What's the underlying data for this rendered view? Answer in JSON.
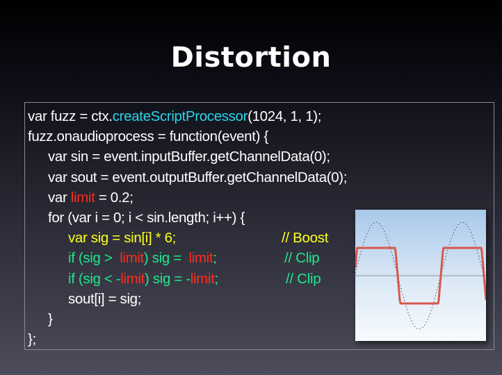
{
  "slide": {
    "title": "Distortion"
  },
  "colors": {
    "default": "#ffffff",
    "cyan": "#27d6ea",
    "red": "#ff2b1c",
    "yellow": "#ffff1e",
    "green": "#1fe88a",
    "clip_curve": "#d9574c",
    "axis": "#9ea4ab",
    "sine_dots": "#444a55"
  },
  "code": {
    "lines": [
      {
        "indent": 0,
        "segments": [
          {
            "text": "var fuzz = ctx.",
            "color": "default"
          },
          {
            "text": "createScriptProcessor",
            "color": "cyan"
          },
          {
            "text": "(1024, 1, 1);",
            "color": "default"
          }
        ]
      },
      {
        "indent": 0,
        "segments": [
          {
            "text": "fuzz.onaudioprocess = function(event) {",
            "color": "default"
          }
        ]
      },
      {
        "indent": 1,
        "segments": [
          {
            "text": "var sin = event.inputBuffer.getChannelData(0);",
            "color": "default"
          }
        ]
      },
      {
        "indent": 1,
        "segments": [
          {
            "text": "var sout = event.outputBuffer.getChannelData(0);",
            "color": "default"
          }
        ]
      },
      {
        "indent": 1,
        "segments": [
          {
            "text": "var ",
            "color": "default"
          },
          {
            "text": "limit",
            "color": "red"
          },
          {
            "text": " = 0.2;",
            "color": "default"
          }
        ]
      },
      {
        "indent": 1,
        "segments": [
          {
            "text": "for (var i = 0; i < sin.length; i++) {",
            "color": "default"
          }
        ]
      },
      {
        "indent": 2,
        "segments": [
          {
            "text": "var sig = sin[i] * 6;",
            "color": "yellow"
          }
        ],
        "comment": {
          "text": "// Boost",
          "color": "yellow",
          "offset": 369
        }
      },
      {
        "indent": 2,
        "segments": [
          {
            "text": "if (sig >  ",
            "color": "green"
          },
          {
            "text": "limit",
            "color": "red"
          },
          {
            "text": ") sig =  ",
            "color": "green"
          },
          {
            "text": "limit",
            "color": "red"
          },
          {
            "text": ";",
            "color": "green"
          }
        ],
        "comment": {
          "text": "// Clip",
          "color": "green",
          "offset": 373
        }
      },
      {
        "indent": 2,
        "segments": [
          {
            "text": "if (sig < -",
            "color": "green"
          },
          {
            "text": "limit",
            "color": "red"
          },
          {
            "text": ") sig = -",
            "color": "green"
          },
          {
            "text": "limit",
            "color": "red"
          },
          {
            "text": ";",
            "color": "green"
          }
        ],
        "comment": {
          "text": "// Clip",
          "color": "green",
          "offset": 375
        }
      },
      {
        "indent": 2,
        "segments": [
          {
            "text": "sout[i] = sig;",
            "color": "default"
          }
        ]
      },
      {
        "indent": 1,
        "segments": [
          {
            "text": "}",
            "color": "default"
          }
        ]
      },
      {
        "indent": 0,
        "segments": [
          {
            "text": "};",
            "color": "default"
          }
        ]
      }
    ]
  },
  "figure": {
    "description_label": "clipped sine wave",
    "input_amplitude": 1.0,
    "clip_level": 0.52,
    "cycles_shown": 1.5
  }
}
